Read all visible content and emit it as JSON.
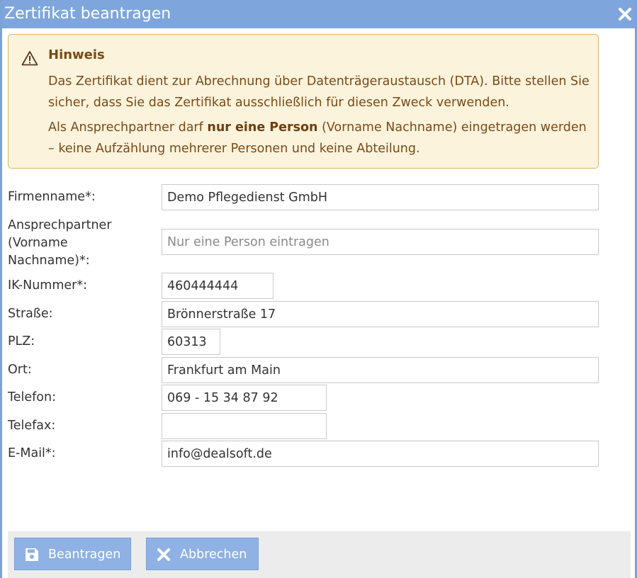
{
  "dialog": {
    "title": "Zertifikat beantragen",
    "close_icon": "close-icon"
  },
  "notice": {
    "icon": "warning-icon",
    "heading": "Hinweis",
    "paragraph1": "Das Zertifikat dient zur Abrechnung über Datenträgeraustausch (DTA). Bitte stellen Sie sicher, dass Sie das Zertifikat ausschließlich für diesen Zweck verwenden.",
    "paragraph2_before": "Als Ansprechpartner darf ",
    "paragraph2_bold": "nur eine Person",
    "paragraph2_after": " (Vorname Nachname) eingetragen werden – keine Aufzählung mehrerer Personen und keine Abteilung."
  },
  "form": {
    "firmenname": {
      "label": "Firmenname*:",
      "value": "Demo Pflegedienst GmbH"
    },
    "ansprechpartner": {
      "label": "Ansprechpartner (Vorname Nachname)*:",
      "value": "",
      "placeholder": "Nur eine Person eintragen"
    },
    "ik_nummer": {
      "label": "IK-Nummer*:",
      "value": "460444444"
    },
    "strasse": {
      "label": "Straße:",
      "value": "Brönnerstraße 17"
    },
    "plz": {
      "label": "PLZ:",
      "value": "60313"
    },
    "ort": {
      "label": "Ort:",
      "value": "Frankfurt am Main"
    },
    "telefon": {
      "label": "Telefon:",
      "value": "069 - 15 34 87 92"
    },
    "telefax": {
      "label": "Telefax:",
      "value": ""
    },
    "email": {
      "label": "E-Mail*:",
      "value": "info@dealsoft.de"
    }
  },
  "footer": {
    "submit": {
      "label": "Beantragen",
      "icon": "save-icon"
    },
    "cancel": {
      "label": "Abbrechen",
      "icon": "close-icon"
    }
  },
  "colors": {
    "titlebar": "#7ea6dc",
    "notice_bg": "#fcf3dc",
    "notice_text": "#7a4a16",
    "button": "#8fb1e3"
  }
}
